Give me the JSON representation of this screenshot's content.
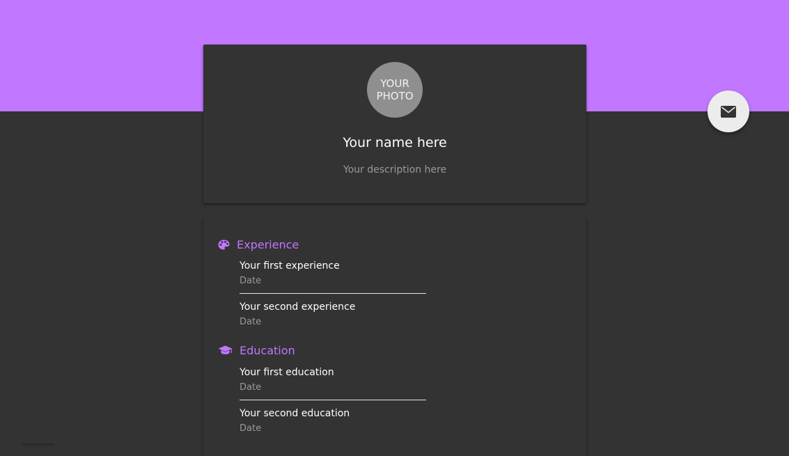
{
  "colors": {
    "accent": "#c177ff",
    "background": "#333333",
    "text_primary": "#ffffff",
    "text_secondary": "#9a9a9a"
  },
  "profile": {
    "photo_text": "YOUR\nPHOTO",
    "name": "Your name here",
    "description": "Your description here"
  },
  "contact": {
    "icon": "envelope-icon"
  },
  "experience": {
    "heading": "Experience",
    "icon": "palette-icon",
    "items": [
      {
        "title": "Your first experience",
        "date": "Date"
      },
      {
        "title": "Your second experience",
        "date": "Date"
      }
    ]
  },
  "education": {
    "heading": "Education",
    "icon": "graduation-cap-icon",
    "items": [
      {
        "title": "Your first education",
        "date": "Date"
      },
      {
        "title": "Your second education",
        "date": "Date"
      }
    ]
  }
}
